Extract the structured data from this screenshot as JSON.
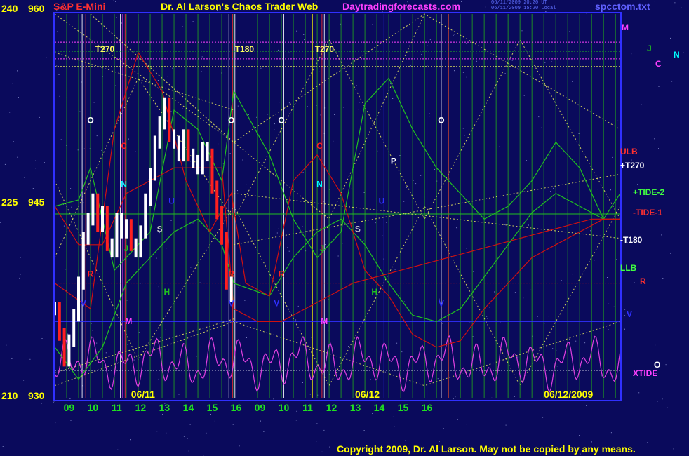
{
  "header": {
    "symbol": "S&P E-Mini",
    "title": "Dr. Al Larson's Chaos Trader Web",
    "site": "Daytradingforecasts.com",
    "file": "spcctom.txt",
    "stamp": [
      "06/11/2009 20:20 UT",
      "06/11/2009 15:20 Local"
    ]
  },
  "footer": {
    "copyright": "Copyright 2009, Dr. Al Larson. May not be copied by any means."
  },
  "colors": {
    "background": "#0a0a5c",
    "price_bar": "#ffffff",
    "price_down": "#ff2020",
    "flux_green": "#20c020",
    "flux_red": "#d01010",
    "xtide": "#e040e0",
    "projection": "#ffff60",
    "frame": "#3030ff"
  },
  "chart_data": {
    "type": "line",
    "title": "S&P E-Mini",
    "y_axis": {
      "ticks": [
        {
          "left": "240",
          "right": "960",
          "value": 960
        },
        {
          "left": "225",
          "right": "945",
          "value": 945
        },
        {
          "left": "210",
          "right": "930",
          "value": 930
        }
      ],
      "ylim": [
        930,
        960
      ]
    },
    "x_axis": {
      "hour_labels": [
        "09",
        "10",
        "11",
        "12",
        "13",
        "14",
        "15",
        "16",
        "09",
        "10",
        "11",
        "12",
        "13",
        "14",
        "15",
        "16"
      ],
      "day_labels": [
        "06/11",
        "06/12",
        "06/12/2009"
      ],
      "xlim": [
        8.5,
        32.2
      ]
    },
    "price_series": {
      "name": "S&P E-Mini",
      "x": [
        8.5,
        8.7,
        8.9,
        9.1,
        9.3,
        9.5,
        9.7,
        9.9,
        10.1,
        10.3,
        10.5,
        10.7,
        10.9,
        11.1,
        11.3,
        11.5,
        11.7,
        11.9,
        12.1,
        12.3,
        12.5,
        12.7,
        12.9,
        13.1,
        13.3,
        13.5,
        13.7,
        13.9,
        14.1,
        14.3,
        14.5,
        14.7,
        14.9,
        15.1,
        15.3,
        15.5,
        15.7,
        15.9
      ],
      "close": [
        937.0,
        935.0,
        933.0,
        934.5,
        936.5,
        939.0,
        942.5,
        944.0,
        945.5,
        943.5,
        944.5,
        942.0,
        941.5,
        944.0,
        943.0,
        943.5,
        942.0,
        941.5,
        943.0,
        945.5,
        947.5,
        950.0,
        951.5,
        953.0,
        950.5,
        950.0,
        949.0,
        950.5,
        949.0,
        948.5,
        948.0,
        949.5,
        949.0,
        946.5,
        944.5,
        942.5,
        939.0,
        938.0
      ]
    },
    "flux_lines": [
      {
        "name": "green-upper",
        "x": [
          8.5,
          9.5,
          10.0,
          11.0,
          12.5,
          13.5,
          14.5,
          15.5,
          16.0,
          17.5,
          18.5,
          19.5,
          20.5,
          21.5,
          22.5,
          23.5,
          24.5,
          25.5,
          26.5,
          27.5,
          28.5,
          29.5,
          30.5,
          31.5,
          32.2
        ],
        "y": [
          945,
          945.5,
          948,
          940,
          943,
          952.5,
          951,
          947,
          954,
          949,
          944,
          941,
          943,
          953,
          955,
          951,
          948,
          946,
          944,
          945,
          947,
          950,
          948,
          944,
          946
        ]
      },
      {
        "name": "green-lower",
        "x": [
          8.5,
          9.5,
          10.5,
          11.5,
          12.5,
          13.5,
          14.5,
          15.5,
          16.0,
          17.5,
          18.5,
          19.5,
          20.5,
          21.5,
          22.5,
          23.5,
          24.5,
          25.5,
          26.5,
          27.5,
          28.5,
          29.5,
          30.5,
          31.5,
          32.2
        ],
        "y": [
          934,
          931.5,
          934,
          939,
          941,
          943,
          944,
          942,
          939,
          938,
          941,
          943,
          944,
          942,
          939,
          936.5,
          936,
          937,
          939.5,
          942,
          944.5,
          946,
          945,
          944,
          944
        ]
      },
      {
        "name": "red-upper",
        "x": [
          8.5,
          10.0,
          11.0,
          12.0,
          13.0,
          14.0,
          15.0,
          15.9,
          16.5,
          17.5,
          18.5,
          19.5,
          20.5,
          21.5,
          22.5,
          23.5,
          24.5,
          25.5,
          26.5,
          27.5,
          28.5,
          29.5,
          30.5,
          31.5,
          32.2
        ],
        "y": [
          939,
          937,
          951,
          957,
          954,
          947,
          943,
          946,
          939,
          938,
          947,
          949,
          946,
          940,
          938,
          935,
          934,
          934.5,
          937,
          939,
          941,
          942,
          943,
          944,
          944
        ]
      },
      {
        "name": "red-lower",
        "x": [
          8.5,
          9.5,
          10.5,
          11.5,
          12.5,
          13.5,
          14.5,
          15.5,
          16.0,
          17.0,
          18.0,
          19.0,
          20.0,
          21.0,
          22.0,
          23.0,
          24.0,
          25.0,
          26.0,
          27.0,
          28.0,
          29.0,
          30.0,
          31.0,
          32.2
        ],
        "y": [
          945,
          942,
          942,
          946,
          947,
          948,
          948,
          948,
          937,
          936,
          936,
          937,
          938,
          939,
          939.5,
          940,
          940.5,
          941,
          941.5,
          942,
          942.5,
          943,
          943.5,
          944,
          944
        ]
      }
    ],
    "xtide": {
      "name": "XTIDE"
    },
    "guide_labels": [
      "ULB",
      "+T270",
      "+TIDE-2",
      "-TIDE-1",
      "-T180",
      "LLB",
      "R",
      "V",
      "XTIDE",
      "O",
      "M",
      "J",
      "C",
      "N"
    ],
    "top_labels": [
      "T270",
      "T180",
      "T270"
    ],
    "planet_marks": [
      {
        "label": "O",
        "x": 10.0,
        "y": 951.5,
        "color": "#ffffff"
      },
      {
        "label": "C",
        "x": 11.4,
        "y": 949.5,
        "color": "#ff2020"
      },
      {
        "label": "N",
        "x": 11.4,
        "y": 946.5,
        "color": "#00ffff"
      },
      {
        "label": "R",
        "x": 10.0,
        "y": 939.5,
        "color": "#ff2020"
      },
      {
        "label": "J",
        "x": 11.5,
        "y": 941.5,
        "color": "#20c020"
      },
      {
        "label": "M",
        "x": 11.6,
        "y": 935.8,
        "color": "#ff40ff"
      },
      {
        "label": "V",
        "x": 9.7,
        "y": 937.2,
        "color": "#3030ff"
      },
      {
        "label": "S",
        "x": 12.9,
        "y": 943.0,
        "color": "#c0c0c0"
      },
      {
        "label": "U",
        "x": 13.4,
        "y": 945.2,
        "color": "#3030ff"
      },
      {
        "label": "H",
        "x": 13.2,
        "y": 938.1,
        "color": "#20c020"
      },
      {
        "label": "O",
        "x": 15.9,
        "y": 951.5,
        "color": "#ffffff"
      },
      {
        "label": "R",
        "x": 15.9,
        "y": 939.5,
        "color": "#ff2020"
      },
      {
        "label": "V",
        "x": 15.9,
        "y": 937.2,
        "color": "#3030ff"
      },
      {
        "label": "O",
        "x": 18.0,
        "y": 951.5,
        "color": "#ffffff"
      },
      {
        "label": "R",
        "x": 18.0,
        "y": 939.5,
        "color": "#ff2020"
      },
      {
        "label": "V",
        "x": 17.8,
        "y": 937.2,
        "color": "#3030ff"
      },
      {
        "label": "C",
        "x": 19.6,
        "y": 949.5,
        "color": "#ff2020"
      },
      {
        "label": "N",
        "x": 19.6,
        "y": 946.5,
        "color": "#00ffff"
      },
      {
        "label": "J",
        "x": 19.7,
        "y": 941.5,
        "color": "#20c020"
      },
      {
        "label": "M",
        "x": 19.8,
        "y": 935.8,
        "color": "#ff40ff"
      },
      {
        "label": "S",
        "x": 21.2,
        "y": 943.0,
        "color": "#c0c0c0"
      },
      {
        "label": "H",
        "x": 21.9,
        "y": 938.1,
        "color": "#20c020"
      },
      {
        "label": "U",
        "x": 22.2,
        "y": 945.2,
        "color": "#3030ff"
      },
      {
        "label": "P",
        "x": 22.7,
        "y": 948.3,
        "color": "#ffffff"
      },
      {
        "label": "O",
        "x": 24.7,
        "y": 951.5,
        "color": "#ffffff"
      },
      {
        "label": "V",
        "x": 24.7,
        "y": 937.2,
        "color": "#3030ff"
      }
    ],
    "legend_planets": [
      {
        "label": "M",
        "color": "#ff40ff"
      },
      {
        "label": "J",
        "color": "#20c020"
      },
      {
        "label": "C",
        "color": "#ff40ff"
      },
      {
        "label": "N",
        "color": "#00ffff"
      }
    ]
  }
}
